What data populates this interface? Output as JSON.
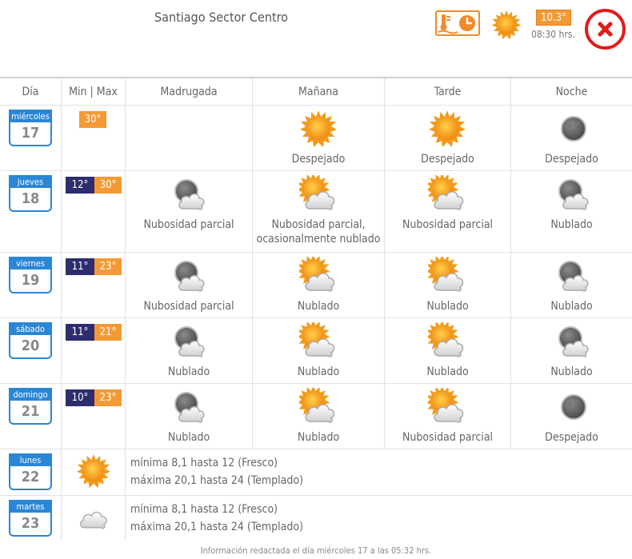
{
  "header": {
    "title": "Santiago Sector Centro",
    "current_temp": "10.3°",
    "current_time": "08:30 hrs."
  },
  "columns": {
    "dia": "Día",
    "minmax": "Min | Max",
    "madrugada": "Madrugada",
    "manana": "Mañana",
    "tarde": "Tarde",
    "noche": "Noche"
  },
  "days": [
    {
      "weekday": "miércoles",
      "day": "17",
      "min": "",
      "max": "30°",
      "madrugada": {
        "icon": "",
        "text": ""
      },
      "manana": {
        "icon": "sun-icon",
        "text": "Despejado"
      },
      "tarde": {
        "icon": "sun-icon",
        "text": "Despejado"
      },
      "noche": {
        "icon": "moon-icon",
        "text": "Despejado"
      }
    },
    {
      "weekday": "jueves",
      "day": "18",
      "min": "12°",
      "max": "30°",
      "madrugada": {
        "icon": "moon-cloud-icon",
        "text": "Nubosidad parcial"
      },
      "manana": {
        "icon": "sun-cloud-icon",
        "text": "Nubosidad parcial,",
        "text2": "ocasionalmente nublado"
      },
      "tarde": {
        "icon": "sun-cloud-icon",
        "text": "Nubosidad parcial"
      },
      "noche": {
        "icon": "moon-cloud-icon",
        "text": "Nublado"
      }
    },
    {
      "weekday": "viernes",
      "day": "19",
      "min": "11°",
      "max": "23°",
      "madrugada": {
        "icon": "moon-cloud-icon",
        "text": "Nubosidad parcial"
      },
      "manana": {
        "icon": "sun-cloud-icon",
        "text": "Nublado"
      },
      "tarde": {
        "icon": "sun-cloud-icon",
        "text": "Nublado"
      },
      "noche": {
        "icon": "moon-cloud-icon",
        "text": "Nublado"
      }
    },
    {
      "weekday": "sábado",
      "day": "20",
      "min": "11°",
      "max": "21°",
      "madrugada": {
        "icon": "moon-cloud-icon",
        "text": "Nublado"
      },
      "manana": {
        "icon": "sun-cloud-icon",
        "text": "Nublado"
      },
      "tarde": {
        "icon": "sun-cloud-icon",
        "text": "Nublado"
      },
      "noche": {
        "icon": "moon-cloud-icon",
        "text": "Nublado"
      }
    },
    {
      "weekday": "domingo",
      "day": "21",
      "min": "10°",
      "max": "23°",
      "madrugada": {
        "icon": "moon-cloud-icon",
        "text": "Nublado"
      },
      "manana": {
        "icon": "sun-cloud-icon",
        "text": "Nublado"
      },
      "tarde": {
        "icon": "sun-cloud-icon",
        "text": "Nubosidad parcial"
      },
      "noche": {
        "icon": "moon-icon",
        "text": "Despejado"
      }
    }
  ],
  "extended": [
    {
      "weekday": "lunes",
      "day": "22",
      "icon": "sun-icon",
      "line1": "mínima 8,1 hasta 12 (Fresco)",
      "line2": "máxima 20,1 hasta 24 (Templado)"
    },
    {
      "weekday": "martes",
      "day": "23",
      "icon": "cloud-icon",
      "line1": "mínima 8,1 hasta 12 (Fresco)",
      "line2": "máxima 20,1 hasta 24 (Templado)"
    }
  ],
  "footer": "Información redactada el día miércoles 17 a las 05:32 hrs.",
  "colors": {
    "accent": "#f49a35",
    "min_bg": "#2c2c6e",
    "calendar": "#2a86d6",
    "close": "#e21b1b"
  }
}
